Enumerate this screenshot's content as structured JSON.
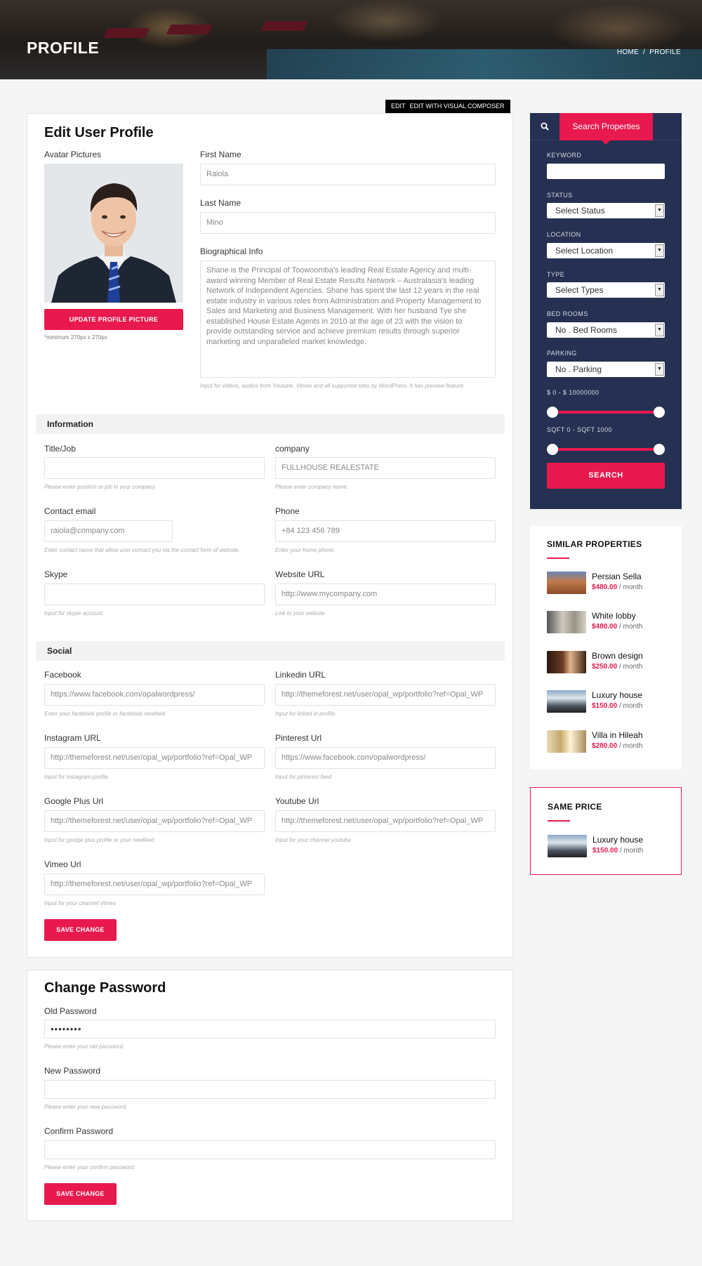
{
  "hero": {
    "title": "PROFILE",
    "breadcrumb_home": "HOME",
    "breadcrumb_sep": "/",
    "breadcrumb_current": "PROFILE"
  },
  "edit_tag": {
    "edit": "EDIT",
    "visual": "EDIT WITH VISUAL COMPOSER"
  },
  "profile": {
    "title": "Edit User Profile",
    "avatar_label": "Avatar Pictures",
    "update_button": "UPDATE PROFILE PICTURE",
    "avatar_hint": "*minimum 270px x 270px",
    "first_name_label": "First Name",
    "first_name_value": "Raiola",
    "last_name_label": "Last Name",
    "last_name_value": "Mino",
    "bio_label": "Biographical Info",
    "bio_value": "Shane is the Principal of Toowoomba's leading Real Estate Agency and multi-award winning Member of Real Estate Results Network – Australasia's leading Network of Independent Agencies. Shane has spent the last 12 years in the real estate industry in various roles from Administration and Property Management to Sales and Marketing and Business Management. With her husband Tye she established House Estate Agents in 2010 at the age of 23 with the vision to provide outstanding service and achieve premium results through superior marketing and unparalleled market knowledge.",
    "bio_hint": "Input for videos, audios from Youtube, Vimeo and all supported sites by WordPress. It has preview feature."
  },
  "information": {
    "section": "Information",
    "title_label": "Title/Job",
    "title_value": "",
    "title_hint": "Please enter position or job in your company.",
    "company_label": "company",
    "company_value": "FULLHOUSE REALESTATE",
    "company_hint": "Please enter company name.",
    "email_label": "Contact email",
    "email_value": "raiola@company.com",
    "email_hint": "Enter contact name that allow user contact you via the contact form of website.",
    "phone_label": "Phone",
    "phone_value": "+84 123 456 789",
    "phone_hint": "Enter your home phone.",
    "skype_label": "Skype",
    "skype_value": "",
    "skype_hint": "Input for skype account.",
    "website_label": "Website URL",
    "website_value": "http://www.mycompany.com",
    "website_hint": "Link to your website"
  },
  "social": {
    "section": "Social",
    "facebook_label": "Facebook",
    "facebook_value": "https://www.facebook.com/opalwordpress/",
    "facebook_hint": "Enter your facebook profile or facebook newfeed",
    "linkedin_label": "Linkedin URL",
    "linkedin_value": "http://themeforest.net/user/opal_wp/portfolio?ref=Opal_WP",
    "linkedin_hint": "Input for linked in profile.",
    "instagram_label": "Instagram URL",
    "instagram_value": "http://themeforest.net/user/opal_wp/portfolio?ref=Opal_WP",
    "instagram_hint": "Input for instagram profile.",
    "pinterest_label": "Pinterest Url",
    "pinterest_value": "https://www.facebook.com/opalwordpress/",
    "pinterest_hint": "Input for pinterest feed",
    "google_label": "Google Plus Url",
    "google_value": "http://themeforest.net/user/opal_wp/portfolio?ref=Opal_WP",
    "google_hint": "Input for goolge plus profile or your newfeed.",
    "youtube_label": "Youtube Url",
    "youtube_value": "http://themeforest.net/user/opal_wp/portfolio?ref=Opal_WP",
    "youtube_hint": "Input for your channel youtube.",
    "vimeo_label": "Vimeo Url",
    "vimeo_value": "http://themeforest.net/user/opal_wp/portfolio?ref=Opal_WP",
    "vimeo_hint": "Input for your channel Vimeo",
    "save_button": "SAVE CHANGE"
  },
  "password": {
    "title": "Change Password",
    "old_label": "Old Password",
    "old_value": "••••••••",
    "old_hint": "Please enter your old password",
    "new_label": "New Password",
    "new_value": "",
    "new_hint": "Please enter your new password.",
    "confirm_label": "Confirm Password",
    "confirm_value": "",
    "confirm_hint": "Please enter your confirm password.",
    "save_button": "SAVE CHANGE"
  },
  "search": {
    "tab_label": "Search Properties",
    "keyword_label": "KEYWORD",
    "status_label": "STATUS",
    "status_value": "Select Status",
    "location_label": "LOCATION",
    "location_value": "Select Location",
    "type_label": "TYPE",
    "type_value": "Select Types",
    "bedrooms_label": "BED ROOMS",
    "bedrooms_value": "No . Bed Rooms",
    "parking_label": "PARKING",
    "parking_value": "No . Parking",
    "price_label": "$ 0 - $ 10000000",
    "sqft_label": "SQFT 0 - SQFT 1000",
    "button": "SEARCH"
  },
  "similar": {
    "title": "SIMILAR PROPERTIES",
    "items": [
      {
        "name": "Persian Sella",
        "price": "$480.00",
        "per": " / month"
      },
      {
        "name": "White lobby",
        "price": "$480.00",
        "per": " / month"
      },
      {
        "name": "Brown design",
        "price": "$250.00",
        "per": " / month"
      },
      {
        "name": "Luxury house",
        "price": "$150.00",
        "per": " / month"
      },
      {
        "name": "Villa in Hileah",
        "price": "$280.00",
        "per": " / month"
      }
    ]
  },
  "same_price": {
    "title": "SAME PRICE",
    "items": [
      {
        "name": "Luxury house",
        "price": "$150.00",
        "per": " / month"
      }
    ]
  }
}
